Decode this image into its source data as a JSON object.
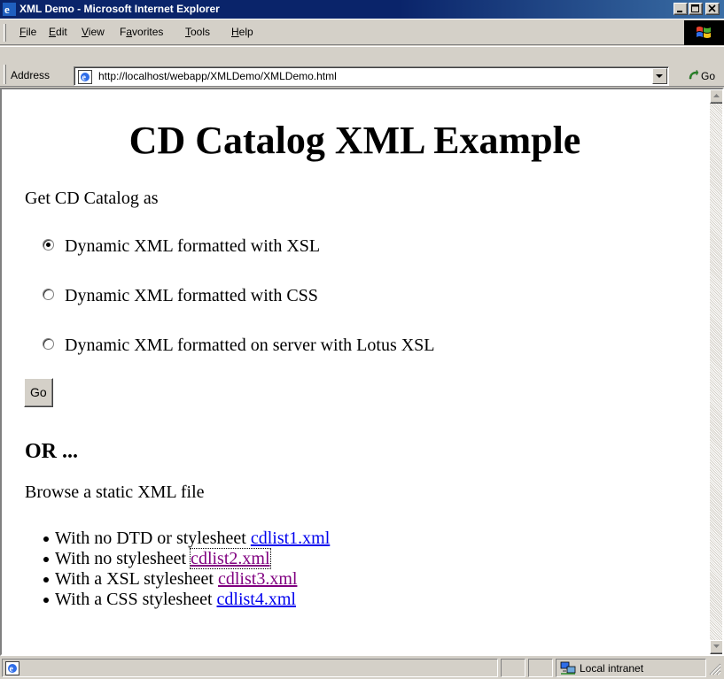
{
  "window": {
    "title": "XML Demo - Microsoft Internet Explorer"
  },
  "menu": {
    "items": [
      {
        "label": "File",
        "accel": "F"
      },
      {
        "label": "Edit",
        "accel": "E"
      },
      {
        "label": "View",
        "accel": "V"
      },
      {
        "label": "Favorites",
        "accel": "a"
      },
      {
        "label": "Tools",
        "accel": "T"
      },
      {
        "label": "Help",
        "accel": "H"
      }
    ]
  },
  "address": {
    "label": "Address",
    "url": "http://localhost/webapp/XMLDemo/XMLDemo.html",
    "go_label": "Go"
  },
  "page": {
    "heading": "CD Catalog XML Example",
    "intro": "Get CD Catalog as",
    "options": [
      {
        "label": "Dynamic XML formatted with XSL",
        "selected": true
      },
      {
        "label": "Dynamic XML formatted with CSS",
        "selected": false
      },
      {
        "label": "Dynamic XML formatted on server with Lotus XSL",
        "selected": false
      }
    ],
    "submit_label": "Go",
    "or_heading": "OR ...",
    "browse_text": "Browse a static XML file",
    "links": [
      {
        "text": "With no DTD or stylesheet",
        "link": "cdlist1.xml",
        "visited": false,
        "focused": false
      },
      {
        "text": "With no stylesheet",
        "link": "cdlist2.xml",
        "visited": true,
        "focused": true
      },
      {
        "text": "With a XSL stylesheet",
        "link": "cdlist3.xml",
        "visited": true,
        "focused": false
      },
      {
        "text": "With a CSS stylesheet",
        "link": "cdlist4.xml",
        "visited": false,
        "focused": false
      }
    ]
  },
  "status": {
    "zone": "Local intranet"
  },
  "colors": {
    "titlebar": "#0a246a",
    "link": "#0000ee",
    "visited_link": "#800080"
  }
}
